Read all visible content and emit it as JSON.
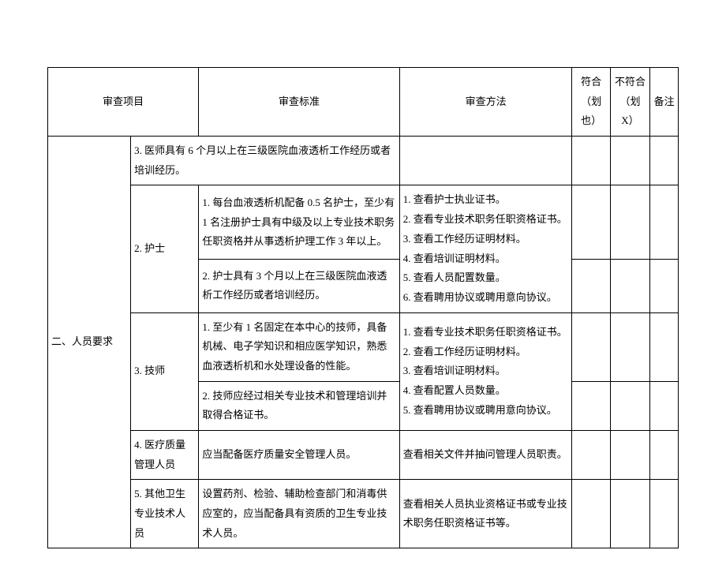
{
  "header": {
    "project": "审查项目",
    "standard": "审查标准",
    "method": "审查方法",
    "conform": "符合（划也）",
    "nonconform": "不符合（划 X）",
    "note": "备注"
  },
  "rows": {
    "category": "二、人员要求",
    "doctor_std": "3. 医师具有 6 个月以上在三级医院血液透析工作经历或者培训经历。",
    "nurse_label": "2. 护士",
    "nurse_std1": "1. 每台血液透析机配备 0.5 名护士，至少有 1 名注册护士具有中级及以上专业技术职务任职资格并从事透析护理工作 3 年以上。",
    "nurse_std2": "2. 护士具有 3 个月以上在三级医院血液透析工作经历或者培训经历。",
    "nurse_method": "1. 查看护士执业证书。\n2. 查看专业技术职务任职资格证书。\n3. 查看工作经历证明材料。\n4. 查看培训证明材料。\n5. 查看人员配置数量。\n6. 查看聘用协议或聘用意向协议。",
    "tech_label": "3. 技师",
    "tech_std1": "1. 至少有 1 名固定在本中心的技师，具备机械、电子学知识和相应医学知识，熟悉血液透析机和水处理设备的性能。",
    "tech_std2": "2. 技师应经过相关专业技术和管理培训并取得合格证书。",
    "tech_method": "1. 查看专业技术职务任职资格证书。\n2. 查看工作经历证明材料。\n3. 查看培训证明材料。\n4. 查看配置人员数量。\n5. 查看聘用协议或聘用意向协议。",
    "qm_label": "4. 医疗质量管理人员",
    "qm_std": "应当配备医疗质量安全管理人员。",
    "qm_method": "查看相关文件并抽问管理人员职责。",
    "other_label": "5. 其他卫生专业技术人员",
    "other_std": "设置药剂、检验、辅助检查部门和消毒供应室的，应当配备具有资质的卫生专业技术人员。",
    "other_method": "查看相关人员执业资格证书或专业技术职务任职资格证书等。"
  }
}
